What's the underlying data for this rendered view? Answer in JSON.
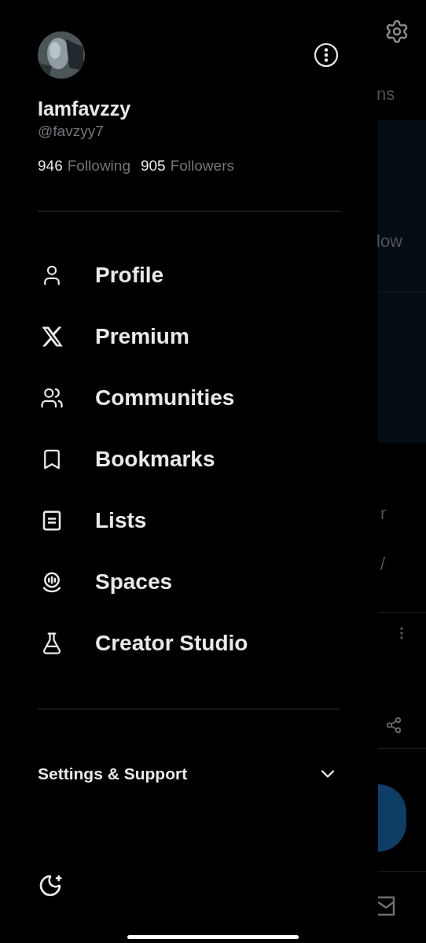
{
  "drawer": {
    "profile": {
      "name": "Iamfavzzy",
      "handle": "@favzyy7",
      "stats": [
        {
          "count": "946",
          "label": "Following"
        },
        {
          "count": "905",
          "label": "Followers"
        }
      ]
    },
    "menu": [
      {
        "label": "Profile",
        "kind": "person"
      },
      {
        "label": "Premium",
        "kind": "x"
      },
      {
        "label": "Communities",
        "kind": "people"
      },
      {
        "label": "Bookmarks",
        "kind": "bookmark"
      },
      {
        "label": "Lists",
        "kind": "list"
      },
      {
        "label": "Spaces",
        "kind": "spaces"
      },
      {
        "label": "Creator Studio",
        "kind": "flask"
      }
    ],
    "settings_section": {
      "label": "Settings & Support",
      "expanded": false
    }
  },
  "background": {
    "fragments": [
      "ns",
      "low",
      "r",
      "/"
    ]
  }
}
